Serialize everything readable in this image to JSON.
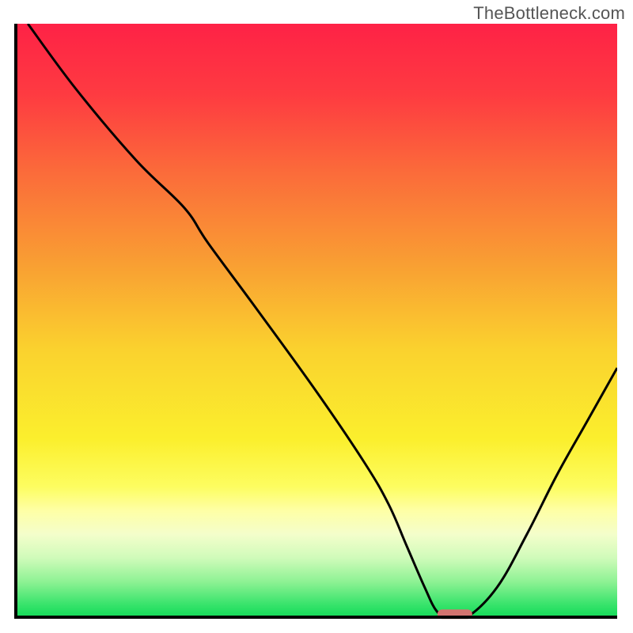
{
  "watermark": "TheBottleneck.com",
  "chart_data": {
    "type": "line",
    "title": "",
    "xlabel": "",
    "ylabel": "",
    "xlim": [
      0,
      100
    ],
    "ylim": [
      0,
      100
    ],
    "grid": false,
    "legend": false,
    "annotations": [],
    "series": [
      {
        "name": "bottleneck-curve",
        "x": [
          2,
          10,
          20,
          28,
          32,
          40,
          50,
          58,
          62,
          65,
          68,
          70,
          72,
          75,
          80,
          85,
          90,
          95,
          100
        ],
        "y": [
          100,
          89,
          77,
          69,
          63,
          52,
          38,
          26,
          19,
          12,
          5,
          1,
          0,
          0,
          5,
          14,
          24,
          33,
          42
        ]
      }
    ],
    "marker": {
      "name": "optimal-point",
      "x": 73,
      "y": 0.5,
      "color": "#d4736f"
    },
    "background_gradient": {
      "stops": [
        {
          "offset": 0.0,
          "color": "#fe2246"
        },
        {
          "offset": 0.12,
          "color": "#fe3b41"
        },
        {
          "offset": 0.25,
          "color": "#fb6b3a"
        },
        {
          "offset": 0.4,
          "color": "#f99d33"
        },
        {
          "offset": 0.55,
          "color": "#fad22e"
        },
        {
          "offset": 0.7,
          "color": "#fbef2d"
        },
        {
          "offset": 0.78,
          "color": "#fdfd60"
        },
        {
          "offset": 0.82,
          "color": "#feffa5"
        },
        {
          "offset": 0.86,
          "color": "#f4fecb"
        },
        {
          "offset": 0.9,
          "color": "#d0fbba"
        },
        {
          "offset": 0.94,
          "color": "#8ef294"
        },
        {
          "offset": 0.98,
          "color": "#35e36a"
        },
        {
          "offset": 1.0,
          "color": "#14db59"
        }
      ]
    },
    "frame_color": "#000000"
  }
}
